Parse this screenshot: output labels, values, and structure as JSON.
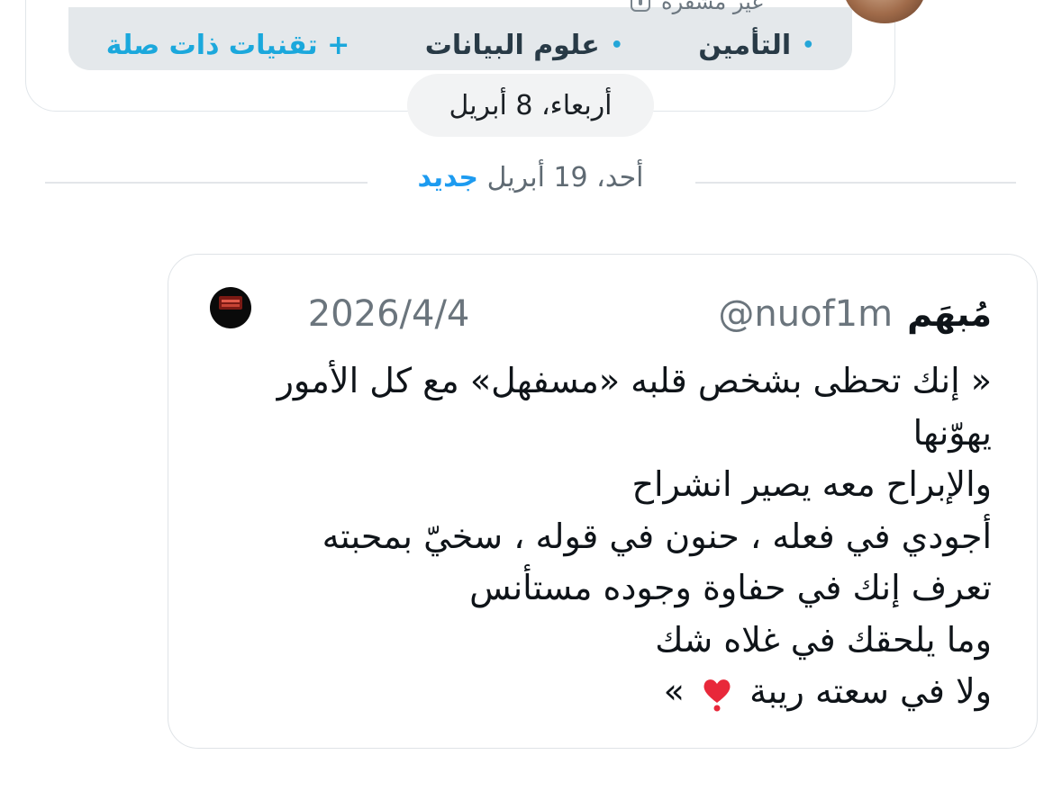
{
  "previous_message": {
    "privacy_label": "غير مشفرة",
    "chips": [
      {
        "label": "التأمين"
      },
      {
        "label": "علوم البيانات"
      },
      {
        "label": "+ تقنيات ذات صلة"
      }
    ]
  },
  "date_separator": {
    "label": "أربعاء، 8 أبريل"
  },
  "new_divider": {
    "date": "أحد، 19 أبريل",
    "new_label": "جديد"
  },
  "quoted_post": {
    "author_name": "مُبهَم",
    "handle": "@nuof1m",
    "date": "2026/4/4",
    "lines": [
      "« إنك تحظى بشخص قلبه «مسفهل» مع كل الأمور",
      "يهوّنها",
      "والإبراح معه يصير انشراح",
      "أجودي في فعله ، حنون في قوله ، سخيّ بمحبته",
      "تعرف إنك في حفاوة وجوده مستأنس",
      "وما يلحقك في غلاه شك",
      "ولا في سعته ريبة"
    ],
    "closing_mark": "»",
    "heart_icon": "heart-exclamation-icon"
  },
  "colors": {
    "accent_blue": "#1d9bf0",
    "text_primary": "#0f1419",
    "text_secondary": "#6b757d",
    "card_border": "#dfe3e7"
  }
}
